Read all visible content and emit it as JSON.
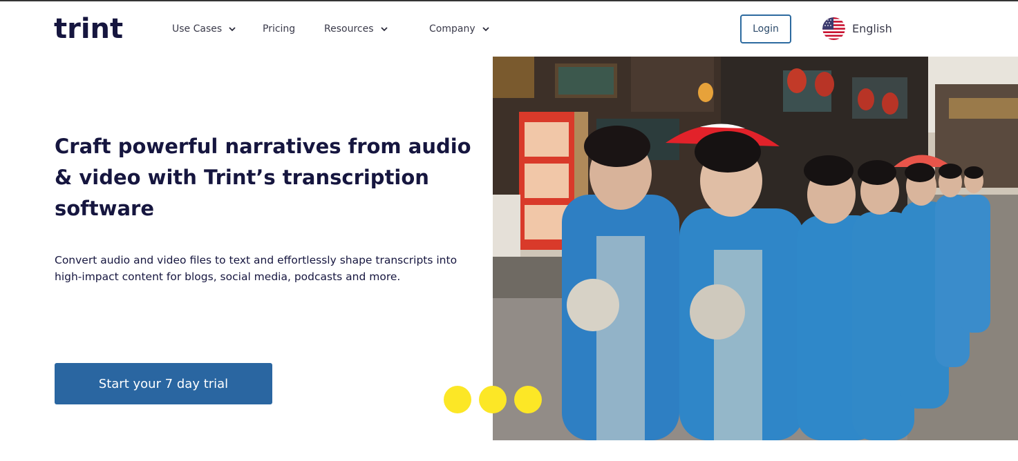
{
  "brand": {
    "logo_text": "trint"
  },
  "nav": {
    "items": [
      {
        "label": "Use Cases",
        "has_dropdown": true
      },
      {
        "label": "Pricing",
        "has_dropdown": false
      },
      {
        "label": "Resources",
        "has_dropdown": true
      },
      {
        "label": "Company",
        "has_dropdown": true
      }
    ],
    "login_label": "Login",
    "language_label": "English",
    "language_icon": "us-flag-icon"
  },
  "hero": {
    "headline": "Craft powerful narratives from audio & video with Trint’s transcription software",
    "subtext": "Convert audio and video files to text and effortlessly shape transcripts into high-impact content for blogs, social media, podcasts and more.",
    "cta_label": "Start your 7 day trial",
    "image_icon": "street-parade-photo",
    "carousel_dot_count": 3
  },
  "colors": {
    "brand_dark": "#16163f",
    "cta_blue": "#2a66a1",
    "login_border": "#2c6a9f",
    "dot_yellow": "#fce726"
  }
}
